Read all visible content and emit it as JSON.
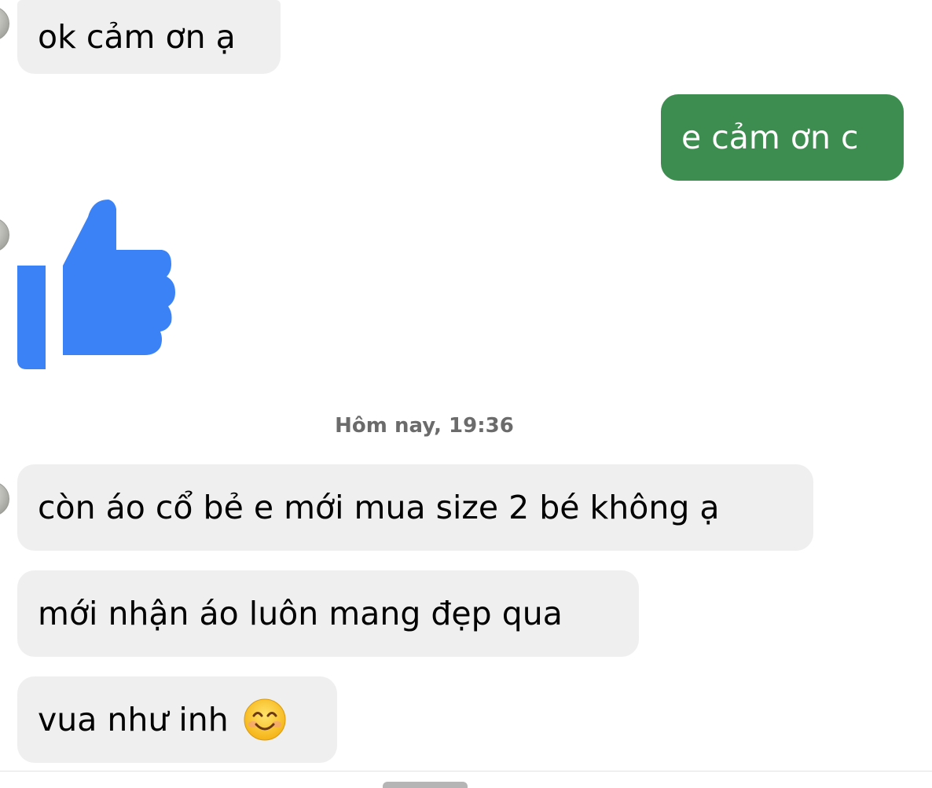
{
  "chat": {
    "messages": [
      {
        "sender": "incoming",
        "text": "ok cảm ơn ạ"
      },
      {
        "sender": "outgoing",
        "text": "e cảm ơn c"
      },
      {
        "sender": "incoming",
        "type": "sticker",
        "icon": "thumbs-up-icon"
      },
      {
        "sender": "incoming",
        "text": "còn áo cổ bẻ e mới mua size 2 bé không ạ"
      },
      {
        "sender": "incoming",
        "text": "mới nhận áo luôn mang đẹp qua"
      },
      {
        "sender": "incoming",
        "text": "vua như inh",
        "emoji": "smiling-face-icon"
      }
    ],
    "timestamp": "Hôm nay, 19:36"
  },
  "colors": {
    "incoming_bubble": "#efefef",
    "outgoing_bubble": "#3c8d4f",
    "like_blue": "#3b82f6",
    "timestamp_text": "#6b6b6b"
  }
}
